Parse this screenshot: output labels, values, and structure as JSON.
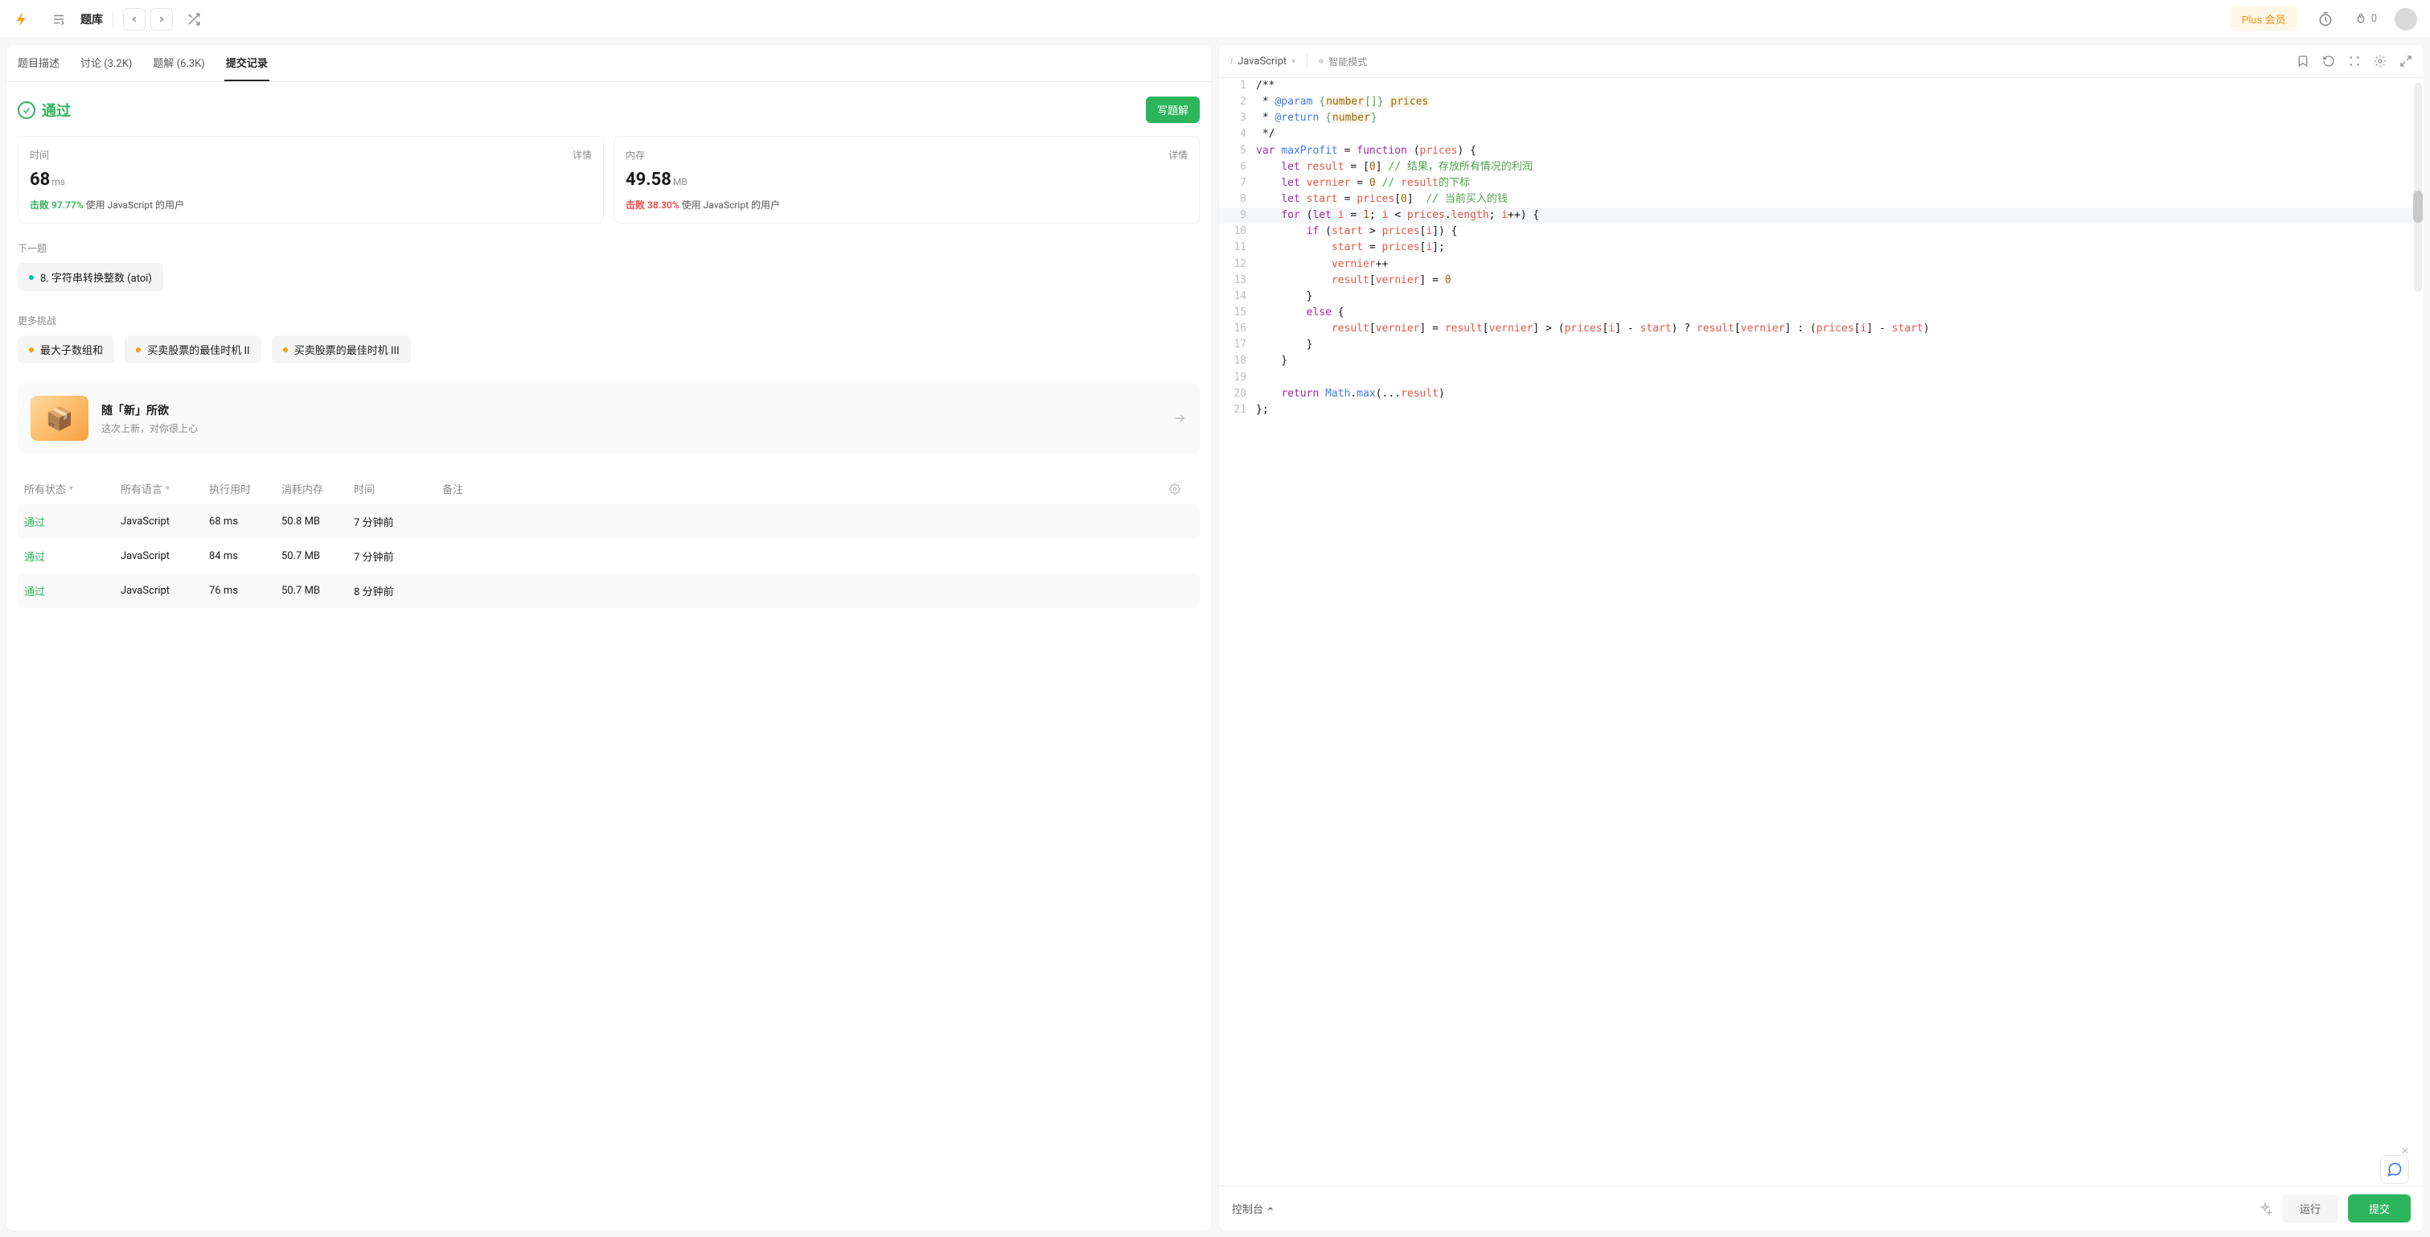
{
  "topbar": {
    "title": "题库",
    "plus_label": "Plus 会员",
    "streak_count": "0"
  },
  "tabs": {
    "desc": "题目描述",
    "discuss": "讨论 (3.2K)",
    "solutions": "题解 (6.3K)",
    "submissions": "提交记录"
  },
  "result": {
    "status": "通过",
    "write_solution": "写题解"
  },
  "metrics": {
    "time": {
      "label": "时间",
      "detail": "详情",
      "value": "68",
      "unit": "ms",
      "beats_prefix": "击败",
      "beats_pct": "97.77%",
      "beats_suffix": "使用 JavaScript 的用户"
    },
    "memory": {
      "label": "内存",
      "detail": "详情",
      "value": "49.58",
      "unit": "MB",
      "beats_prefix": "击败",
      "beats_pct": "38.30%",
      "beats_suffix": "使用 JavaScript 的用户"
    }
  },
  "next_label": "下一题",
  "next_problem": "8. 字符串转换整数 (atoi)",
  "more_label": "更多挑战",
  "challenges": [
    "最大子数组和",
    "买卖股票的最佳时机 II",
    "买卖股票的最佳时机 III"
  ],
  "promo": {
    "title": "随「新」所欲",
    "subtitle": "这次上新，对你很上心"
  },
  "sub_table": {
    "headers": {
      "status": "所有状态",
      "lang": "所有语言",
      "runtime": "执行用时",
      "memory": "消耗内存",
      "time": "时间",
      "note": "备注"
    },
    "rows": [
      {
        "status": "通过",
        "lang": "JavaScript",
        "runtime": "68 ms",
        "memory": "50.8 MB",
        "time": "7 分钟前"
      },
      {
        "status": "通过",
        "lang": "JavaScript",
        "runtime": "84 ms",
        "memory": "50.7 MB",
        "time": "7 分钟前"
      },
      {
        "status": "通过",
        "lang": "JavaScript",
        "runtime": "76 ms",
        "memory": "50.7 MB",
        "time": "8 分钟前"
      }
    ]
  },
  "editor": {
    "language": "JavaScript",
    "smart_mode": "智能模式",
    "console": "控制台",
    "run": "运行",
    "submit": "提交",
    "code_lines": [
      "/**",
      " * @param {number[]} prices",
      " * @return {number}",
      " */",
      "var maxProfit = function (prices) {",
      "    let result = [0] // 结果，存放所有情况的利润",
      "    let vernier = 0 // result的下标",
      "    let start = prices[0]  // 当前买入的钱",
      "    for (let i = 1; i < prices.length; i++) {",
      "        if (start > prices[i]) {",
      "            start = prices[i];",
      "            vernier++",
      "            result[vernier] = 0",
      "        }",
      "        else {",
      "            result[vernier] = result[vernier] > (prices[i] - start) ? result[vernier] : (prices[i] - start)",
      "        }",
      "    }",
      "",
      "    return Math.max(...result)",
      "};"
    ]
  }
}
